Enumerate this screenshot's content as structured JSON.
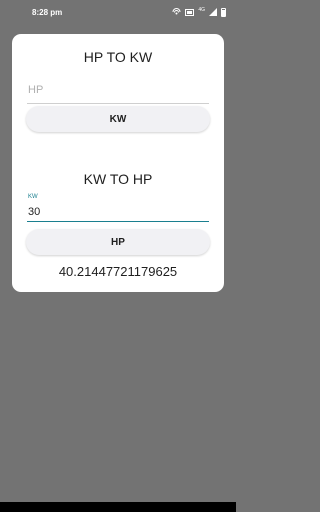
{
  "status_bar": {
    "time": "8:28 pm",
    "network_label": "4G",
    "icons": [
      "hotspot-icon",
      "data-saver-icon",
      "signal-icon",
      "battery-icon"
    ]
  },
  "hp_to_kw": {
    "title": "HP TO KW",
    "input_placeholder": "HP",
    "button_label": "KW"
  },
  "kw_to_hp": {
    "title": "KW TO HP",
    "input_label": "KW",
    "input_value": "30",
    "button_label": "HP",
    "result": "40.21447721179625"
  },
  "colors": {
    "background": "#737373",
    "card": "#ffffff",
    "accent": "#1a7f8f",
    "button": "#f1f1f4"
  }
}
